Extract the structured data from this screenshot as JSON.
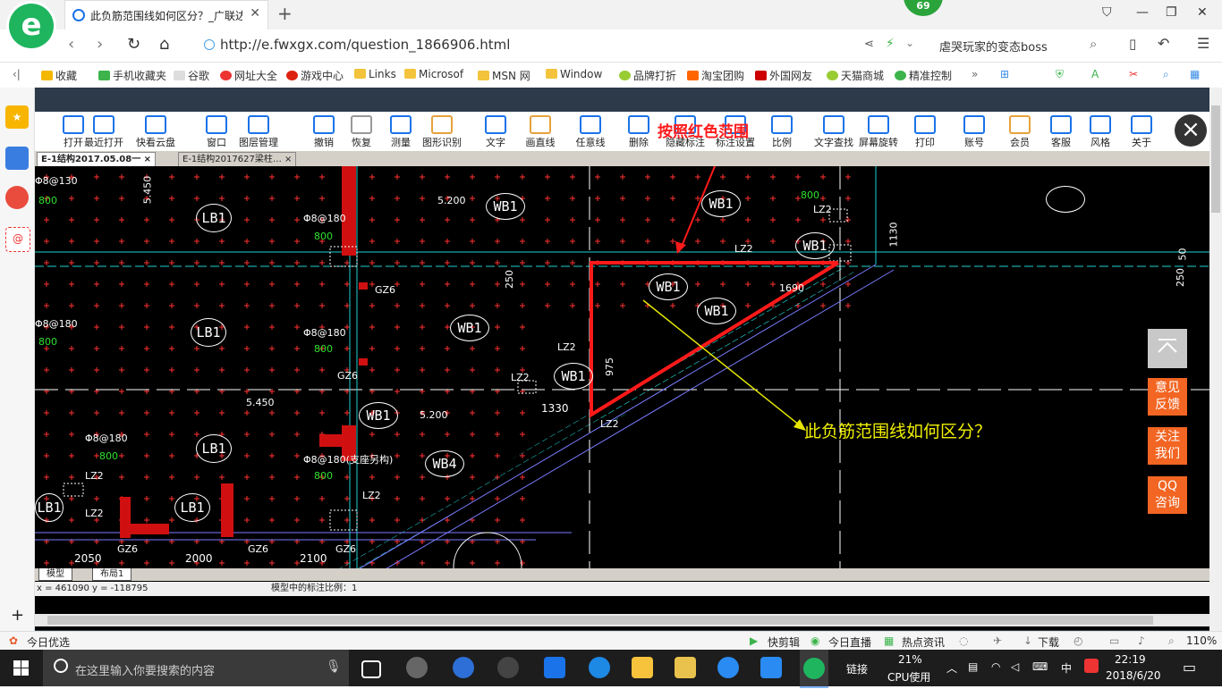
{
  "browser": {
    "tab_title": "此负筋范围线如何区分？_广联达",
    "badge": "69",
    "url": "http://e.fwxgx.com/question_1866906.html",
    "search_text": "虐哭玩家的变态boss",
    "bookmarks": [
      "收藏",
      "手机收藏夹",
      "谷歌",
      "网址大全",
      "游戏中心",
      "Links",
      "Microsof",
      "MSN 网",
      "Window",
      "品牌打折",
      "淘宝团购",
      "外国网友",
      "天猫商城",
      "精准控制"
    ]
  },
  "cad": {
    "toolbar": [
      "打开",
      "最近打开",
      "快看云盘",
      "窗口",
      "图层管理",
      "撤销",
      "恢复",
      "测量",
      "图形识别",
      "文字",
      "画直线",
      "任意线",
      "删除",
      "隐藏标注",
      "标注设置",
      "比例",
      "文字查找",
      "屏幕旋转",
      "打印",
      "账号",
      "会员",
      "客服",
      "风格",
      "关于"
    ],
    "file_tabs": [
      "E-1结构2017.05.08一",
      "E-1结构2017627梁柱…"
    ],
    "layout_tabs": [
      "模型",
      "布局1"
    ],
    "coords": "x = 461090  y = -118795",
    "scale_text": "模型中的标注比例：1",
    "annotation_red": "按照红色范围",
    "annotation_yellow": "此负筋范围线如何区分？",
    "labels": {
      "wb": [
        "WB1",
        "WB1",
        "WB1",
        "WB1",
        "WB1",
        "WB1",
        "WB1",
        "WB1",
        "WB4"
      ],
      "lb": [
        "LB1",
        "LB1",
        "LB1",
        "LB1",
        "LB1"
      ],
      "rebar": [
        "Φ8@130",
        "Φ8@180",
        "Φ8@180",
        "Φ8@180",
        "Φ8@180",
        "Φ8@180(支座另构)"
      ],
      "green_800": "800",
      "dims": [
        "5.450",
        "5.200",
        "5.450",
        "5.200",
        "250",
        "1130",
        "50",
        "250",
        "1690",
        "975",
        "1330",
        "2050",
        "2000",
        "2100"
      ],
      "members": [
        "GZ6",
        "GZ6",
        "GZ6",
        "GZ6",
        "GZ6",
        "LZ2",
        "LZ2",
        "LZ2",
        "LZ2",
        "LZ2",
        "LZ2",
        "LZ2",
        "LZ2"
      ]
    }
  },
  "float_buttons": [
    "意见反馈",
    "关注我们",
    "QQ咨询"
  ],
  "bstatus": {
    "left": "今日优选",
    "items": [
      "快剪辑",
      "今日直播",
      "热点资讯",
      "下载"
    ],
    "zoom": "110%"
  },
  "taskbar": {
    "search_placeholder": "在这里输入你要搜索的内容",
    "link": "链接",
    "cpu_percent": "21%",
    "cpu_label": "CPU使用",
    "ime": "中",
    "time": "22:19",
    "date": "2018/6/20"
  }
}
